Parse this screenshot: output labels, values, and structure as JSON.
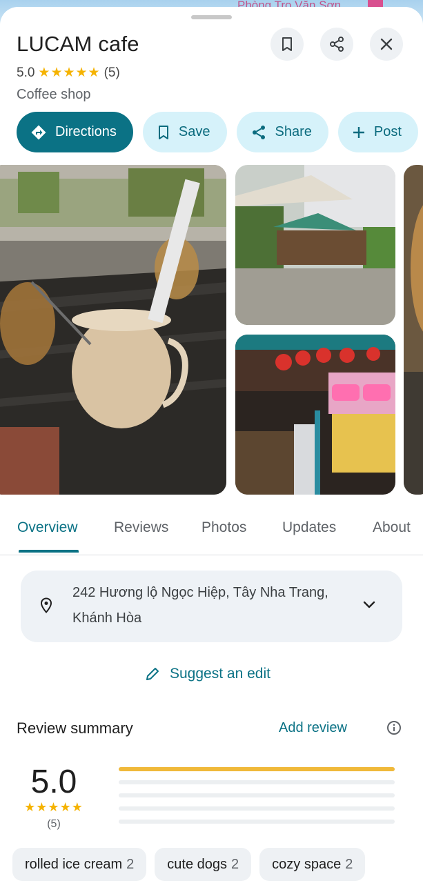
{
  "map": {
    "label": "Phòng Trọ Văn Sơn"
  },
  "place": {
    "title": "LUCAM cafe",
    "rating": "5.0",
    "stars": "★★★★★",
    "review_count": "(5)",
    "category": "Coffee shop"
  },
  "header_buttons": [
    {
      "name": "save-place",
      "icon": "bookmark-icon"
    },
    {
      "name": "share-place",
      "icon": "share-icon"
    },
    {
      "name": "close",
      "icon": "close-icon"
    }
  ],
  "actions": {
    "directions": "Directions",
    "save": "Save",
    "share": "Share",
    "post": "Post"
  },
  "tabs": [
    "Overview",
    "Reviews",
    "Photos",
    "Updates",
    "About"
  ],
  "active_tab": "Overview",
  "address": {
    "line1": "242 Hương lộ Ngọc Hiệp, Tây Nha Trang,",
    "line2": "Khánh Hòa"
  },
  "suggest_edit": "Suggest an edit",
  "review_summary": {
    "title": "Review summary",
    "add_review": "Add review",
    "rating": "5.0",
    "stars": "★★★★★",
    "count": "(5)",
    "distribution": [
      {
        "stars": 5,
        "fraction": 1.0
      },
      {
        "stars": 4,
        "fraction": 0
      },
      {
        "stars": 3,
        "fraction": 0
      },
      {
        "stars": 2,
        "fraction": 0
      },
      {
        "stars": 1,
        "fraction": 0
      }
    ]
  },
  "tags": [
    {
      "label": "rolled ice cream",
      "count": "2"
    },
    {
      "label": "cute dogs",
      "count": "2"
    },
    {
      "label": "cozy space",
      "count": "2"
    }
  ],
  "colors": {
    "accent": "#0b7285",
    "accent_light": "#d6f2fa",
    "star": "#f5b301",
    "bar": "#f0b93a"
  }
}
